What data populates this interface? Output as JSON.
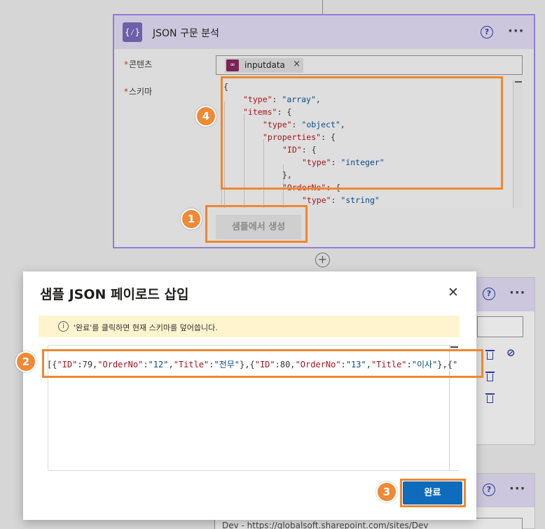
{
  "json_action": {
    "title": "JSON 구문 분석",
    "icon": "{⁄}",
    "help": "?",
    "more": "···",
    "content_label": "콘텐츠",
    "schema_label": "스키마",
    "required_mark": "*",
    "token_label": "inputdata",
    "token_icon": "∞",
    "token_close": "×",
    "generate_button": "샘플에서 생성"
  },
  "schema_code": {
    "l1": "{",
    "l2_key": "\"type\"",
    "l2_val": "\"array\"",
    "l3_key": "\"items\"",
    "l3_brace": "{",
    "l4_key": "\"type\"",
    "l4_val": "\"object\"",
    "l5_key": "\"properties\"",
    "l5_brace": "{",
    "l6_key": "\"ID\"",
    "l6_brace": "{",
    "l7_key": "\"type\"",
    "l7_val": "\"integer\"",
    "l8": "},",
    "l9_key": "\"OrderNo\"",
    "l9_brace": "{",
    "l10_key": "\"type\"",
    "l10_val": "\"string\""
  },
  "add_step": "+",
  "background": {
    "help": "?",
    "more": "···",
    "site_field": "Dev - https://globalsoft.sharepoint.com/sites/Dev"
  },
  "modal": {
    "title": "샘플 JSON 페이로드 삽입",
    "close": "✕",
    "info_icon": "i",
    "info_text": "'완료'를 클릭하면 현재 스키마를 덮어씁니다.",
    "payload_text": "[{\"ID\":79,\"OrderNo\":\"12\",\"Title\":\"전무\"},{\"ID\":80,\"OrderNo\":\"13\",\"Title\":\"이사\"},{\"",
    "done_button": "완료"
  },
  "markers": {
    "m1": "1",
    "m2": "2",
    "m3": "3",
    "m4": "4"
  },
  "colors": {
    "highlight": "#f0872e",
    "primary": "#0f6cbd",
    "card_border": "#8f7dd6",
    "card_header": "#cdc7dd"
  }
}
